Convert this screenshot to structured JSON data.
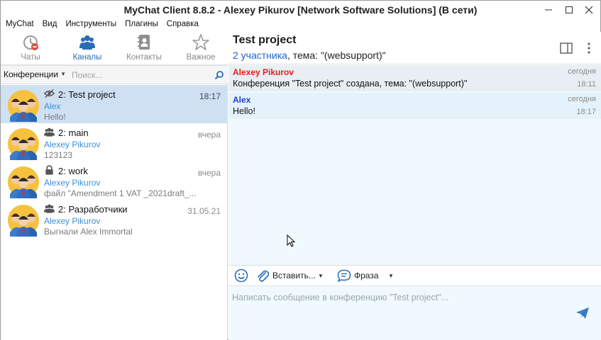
{
  "window": {
    "title": "MyChat Client 8.8.2 - Alexey Pikurov [Network Software Solutions] (В сети)",
    "buttons": {
      "minimize": "—",
      "maximize": "☐",
      "close": "✕"
    }
  },
  "menu": [
    "MyChat",
    "Вид",
    "Инструменты",
    "Плагины",
    "Справка"
  ],
  "nav": {
    "tabs": [
      {
        "label": "Чаты",
        "icon": "clock-history-icon",
        "active": false
      },
      {
        "label": "Каналы",
        "icon": "people-group-icon",
        "active": true
      },
      {
        "label": "Контакты",
        "icon": "address-book-icon",
        "active": false
      },
      {
        "label": "Важное",
        "icon": "star-icon",
        "active": false
      }
    ]
  },
  "filter": {
    "selected": "Конференции",
    "search_placeholder": "Поиск..."
  },
  "conversations": [
    {
      "icon": "eye-hidden-icon",
      "name": "2: Test project",
      "time": "18:17",
      "author": "Alex",
      "preview": "Hello!",
      "selected": true
    },
    {
      "icon": "group-icon",
      "name": "2: main",
      "time": "вчера",
      "author": "Alexey Pikurov",
      "preview": "123123",
      "selected": false
    },
    {
      "icon": "lock-icon",
      "name": "2: work",
      "time": "вчера",
      "author": "Alexey Pikurov",
      "preview": "файл \"Amendment 1 VAT _2021draft_...",
      "selected": false
    },
    {
      "icon": "group-icon",
      "name": "2: Разработчики",
      "time": "31.05.21",
      "author": "Alexey Pikurov",
      "preview": "Выгнали Alex Immortal",
      "selected": false
    }
  ],
  "chat": {
    "title": "Test project",
    "participants_link": "2 участника",
    "topic_text": ", тема: \"(websupport)\""
  },
  "messages": [
    {
      "author": "Alexey Pikurov",
      "author_color": "#e0201b",
      "date": "сегодня",
      "text": "Конференция \"Test project\" создана, тема: \"(websupport)\"",
      "time": "18:11"
    },
    {
      "author": "Alex",
      "author_color": "#1e40c8",
      "date": "сегодня",
      "text": "Hello!",
      "time": "18:17"
    }
  ],
  "compose": {
    "insert_label": "Вставить...",
    "phrase_label": "Фраза",
    "placeholder": "Написать сообщение в конференцию \"Test project\"..."
  },
  "colors": {
    "accent": "#2b6cb8",
    "selected_row": "#cfe0f3",
    "chat_bg": "#f0fafe"
  }
}
